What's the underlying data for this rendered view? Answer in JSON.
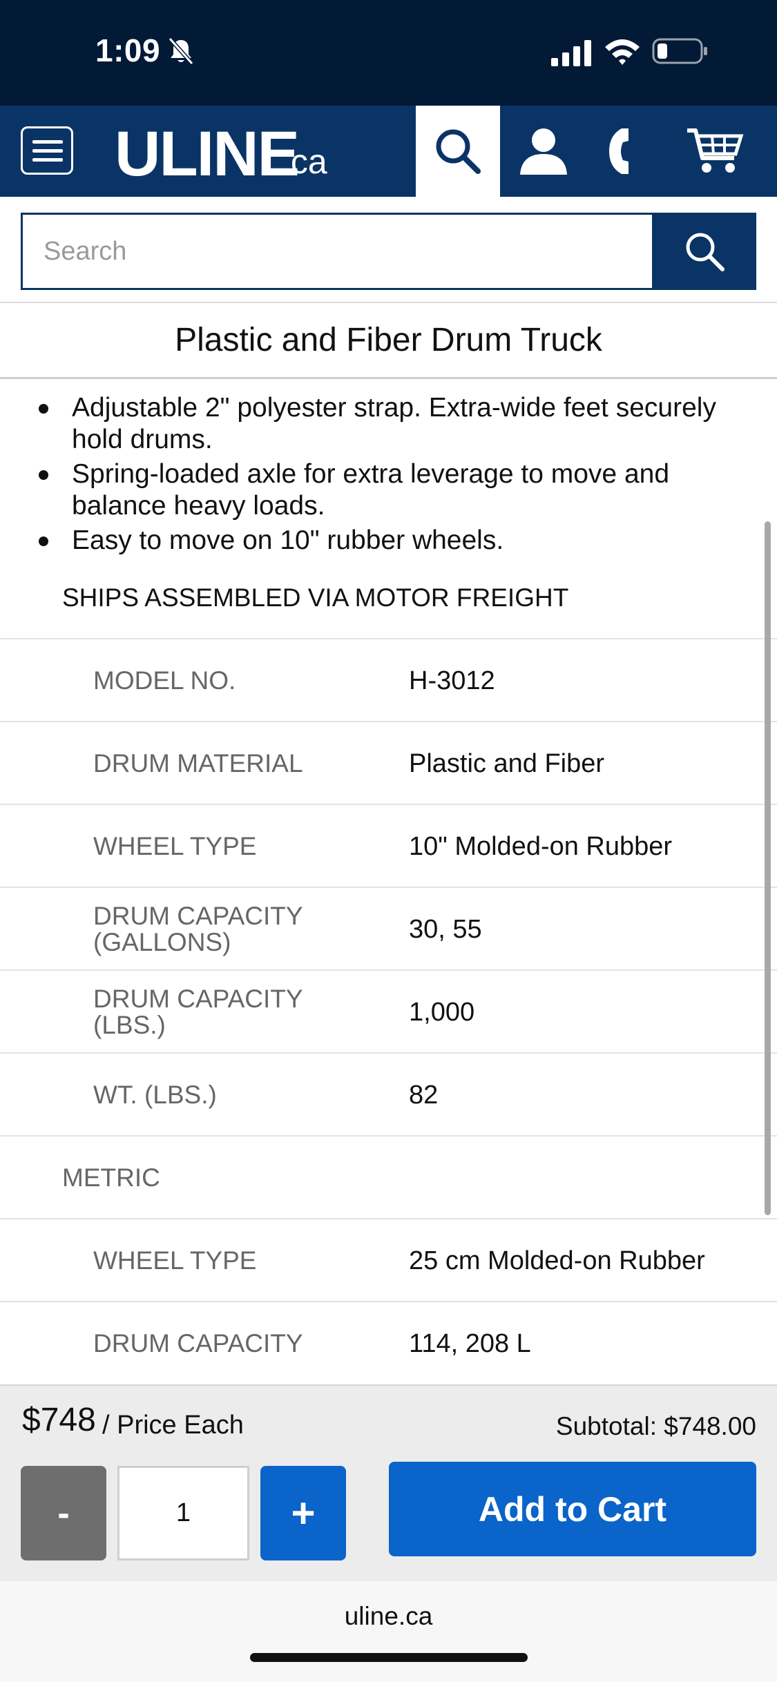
{
  "status_bar": {
    "time": "1:09"
  },
  "header": {
    "logo_text": "ULINE",
    "logo_suffix": ".ca"
  },
  "search": {
    "placeholder": "Search"
  },
  "product": {
    "title": "Plastic and Fiber Drum Truck",
    "bullets": [
      "Adjustable 2\" polyester strap. Extra-wide feet securely hold drums.",
      "Spring-loaded axle for extra leverage to move and balance heavy loads.",
      "Easy to move on 10\" rubber wheels."
    ],
    "ships_note": "SHIPS ASSEMBLED VIA MOTOR FREIGHT",
    "specs": [
      {
        "label": "MODEL NO.",
        "value": "H-3012"
      },
      {
        "label": "DRUM MATERIAL",
        "value": "Plastic and Fiber"
      },
      {
        "label": "WHEEL TYPE",
        "value": "10\" Molded-on Rubber"
      },
      {
        "label": "DRUM CAPACITY (GALLONS)",
        "value": "30, 55"
      },
      {
        "label": "DRUM CAPACITY (LBS.)",
        "value": "1,000"
      },
      {
        "label": "WT. (LBS.)",
        "value": "82"
      }
    ],
    "metric_heading": "METRIC",
    "metric_specs": [
      {
        "label": "WHEEL TYPE",
        "value": "25 cm Molded-on Rubber"
      },
      {
        "label": "DRUM CAPACITY",
        "value": "114, 208 L"
      }
    ]
  },
  "purchase": {
    "price": "$748",
    "price_unit": "/ Price Each",
    "subtotal": "Subtotal: $748.00",
    "minus_label": "-",
    "quantity": "1",
    "plus_label": "+",
    "add_to_cart": "Add to Cart"
  },
  "browser": {
    "url": "uline.ca"
  },
  "colors": {
    "navy": "#0b3466",
    "status_bg": "#021a36",
    "action_blue": "#0a64c9",
    "minus_gray": "#6e6e6e"
  }
}
